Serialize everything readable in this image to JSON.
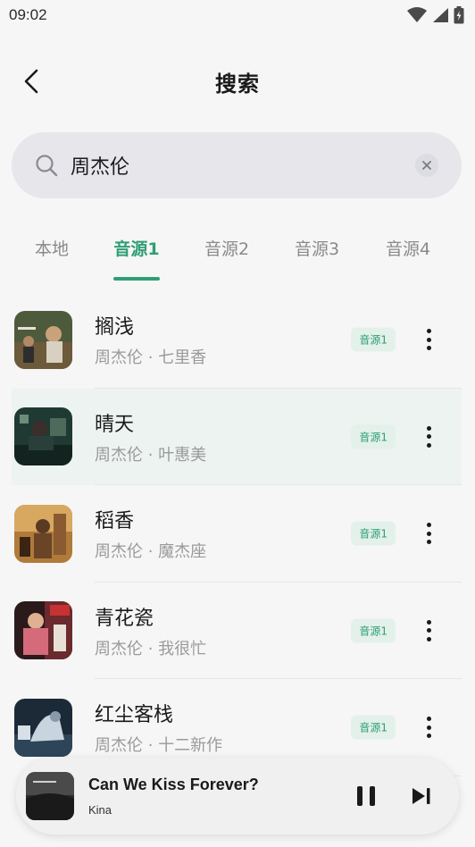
{
  "status_bar": {
    "time": "09:02"
  },
  "header": {
    "title": "搜索"
  },
  "search": {
    "query": "周杰伦"
  },
  "tabs": [
    {
      "label": "本地",
      "active": false
    },
    {
      "label": "音源1",
      "active": true
    },
    {
      "label": "音源2",
      "active": false
    },
    {
      "label": "音源3",
      "active": false
    },
    {
      "label": "音源4",
      "active": false
    }
  ],
  "songs": [
    {
      "title": "搁浅",
      "subtitle": "周杰伦 · 七里香",
      "source": "音源1"
    },
    {
      "title": "晴天",
      "subtitle": "周杰伦 · 叶惠美",
      "source": "音源1"
    },
    {
      "title": "稻香",
      "subtitle": "周杰伦 · 魔杰座",
      "source": "音源1"
    },
    {
      "title": "青花瓷",
      "subtitle": "周杰伦 · 我很忙",
      "source": "音源1"
    },
    {
      "title": "红尘客栈",
      "subtitle": "周杰伦 · 十二新作",
      "source": "音源1"
    }
  ],
  "player": {
    "title": "Can We Kiss Forever?",
    "artist": "Kina"
  },
  "colors": {
    "accent": "#2f9e74",
    "badge_bg": "#e3f1ea",
    "highlight_row": "#edf3f0"
  }
}
